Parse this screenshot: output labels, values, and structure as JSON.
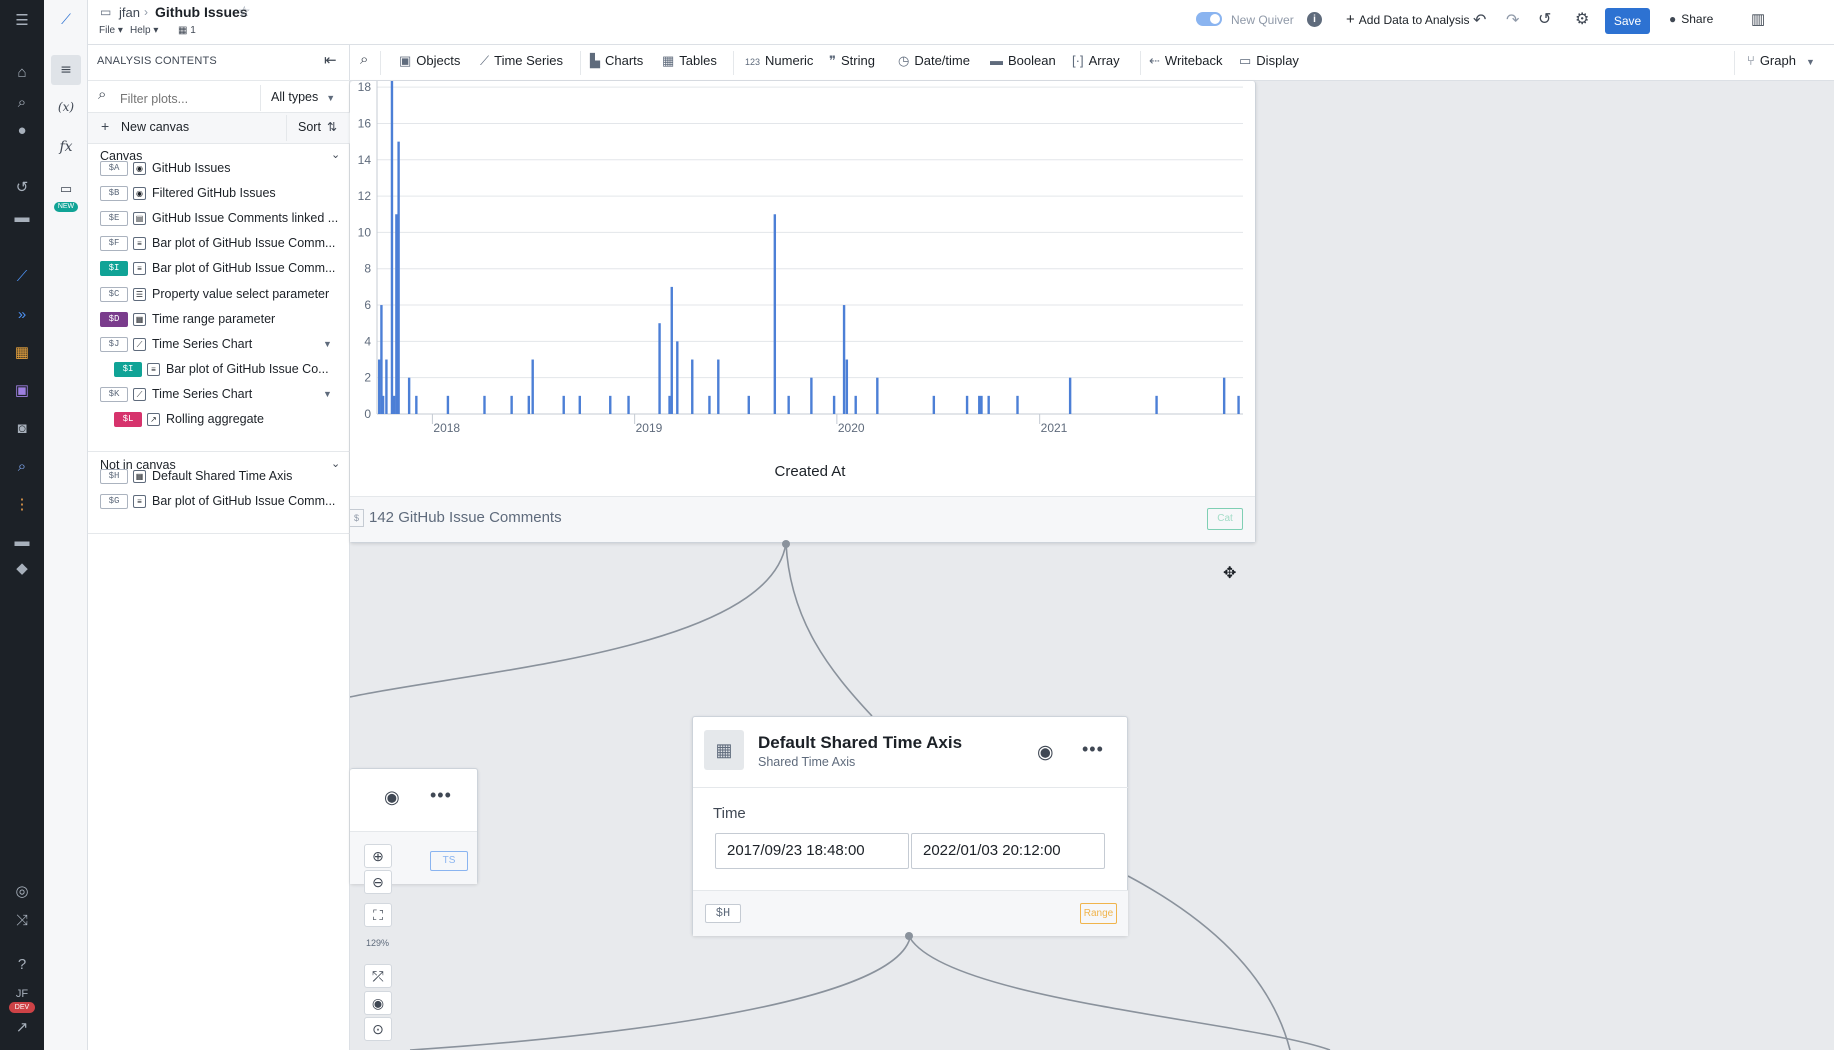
{
  "colors": {
    "accent": "#2d72d2",
    "bar": "#4c7fd6",
    "teal": "#10a396",
    "purple": "#7a3c8c",
    "pink": "#d6336c"
  },
  "header": {
    "breadcrumb_user": "jfan",
    "title": "Github Issues",
    "menu_file": "File",
    "menu_help": "Help",
    "count": "1",
    "new_quiver": "New Quiver",
    "add_data": "Add Data to Analysis",
    "save": "Save",
    "share": "Share"
  },
  "rail": {
    "badge": "NEW"
  },
  "user": {
    "initials": "JF",
    "badge": "DEV"
  },
  "sidebar": {
    "title": "ANALYSIS CONTENTS",
    "filter_placeholder": "Filter plots...",
    "types_select": "All types",
    "new_canvas": "New canvas",
    "sort": "Sort",
    "canvas_header": "Canvas",
    "not_in_canvas_header": "Not in canvas",
    "canvas_items": [
      {
        "tag": "$A",
        "label": "GitHub Issues",
        "icon": "object-set-icon"
      },
      {
        "tag": "$B",
        "label": "Filtered GitHub Issues",
        "icon": "object-set-icon"
      },
      {
        "tag": "$E",
        "label": "GitHub Issue Comments linked ...",
        "icon": "comment-icon"
      },
      {
        "tag": "$F",
        "label": "Bar plot of GitHub Issue Comm...",
        "icon": "bar-plot-icon"
      },
      {
        "tag": "$I",
        "label": "Bar plot of GitHub Issue Comm...",
        "icon": "bar-plot-icon"
      },
      {
        "tag": "$C",
        "label": "Property value select parameter",
        "icon": "list-icon"
      },
      {
        "tag": "$D",
        "label": "Time range parameter",
        "icon": "calendar-icon"
      },
      {
        "tag": "$J",
        "label": "Time Series Chart",
        "icon": "timeseries-icon"
      },
      {
        "tag": "$I",
        "label": "Bar plot of GitHub Issue Co...",
        "icon": "bar-plot-icon"
      },
      {
        "tag": "$K",
        "label": "Time Series Chart",
        "icon": "timeseries-icon"
      },
      {
        "tag": "$L",
        "label": "Rolling aggregate",
        "icon": "rolling-icon"
      }
    ],
    "other_items": [
      {
        "tag": "$H",
        "label": "Default Shared Time Axis",
        "icon": "calendar-icon"
      },
      {
        "tag": "$G",
        "label": "Bar plot of GitHub Issue Comm...",
        "icon": "bar-plot-icon"
      }
    ]
  },
  "toolbar": {
    "objects": "Objects",
    "time_series": "Time Series",
    "charts": "Charts",
    "tables": "Tables",
    "numeric": "Numeric",
    "numeric_glyph": "123",
    "string": "String",
    "datetime": "Date/time",
    "boolean": "Boolean",
    "array": "Array",
    "writeback": "Writeback",
    "display": "Display",
    "graph": "Graph"
  },
  "chart_card": {
    "footer_count": "142 GitHub Issue Comments",
    "footer_badge": "Cat",
    "footer_tag": "$"
  },
  "chart_data": {
    "type": "bar",
    "xlabel": "Created At",
    "ylabel": "",
    "x_ticks": [
      "2018",
      "2019",
      "2020",
      "2021"
    ],
    "y_ticks": [
      0,
      2,
      4,
      6,
      8,
      10,
      12,
      14,
      16,
      18
    ],
    "ylim": [
      0,
      19
    ],
    "xlim": [
      "2017-09-23",
      "2022-01-03"
    ],
    "series": [
      {
        "x": [
          "2017-09-27",
          "2017-10-01",
          "2017-10-04",
          "2017-10-10",
          "2017-10-20",
          "2017-10-24",
          "2017-10-28",
          "2017-11-01",
          "2017-11-20",
          "2017-12-03",
          "2018-01-29",
          "2018-04-05",
          "2018-05-24",
          "2018-06-24",
          "2018-07-01",
          "2018-08-26",
          "2018-09-24",
          "2018-11-18",
          "2018-12-21",
          "2019-02-15",
          "2019-03-05",
          "2019-03-09",
          "2019-03-19",
          "2019-04-15",
          "2019-05-16",
          "2019-06-01",
          "2019-07-26",
          "2019-09-11",
          "2019-10-06",
          "2019-11-16",
          "2019-12-27",
          "2020-01-14",
          "2020-01-19",
          "2020-02-04",
          "2020-03-14",
          "2020-06-24",
          "2020-08-23",
          "2020-09-14",
          "2020-09-18",
          "2020-10-01",
          "2020-11-22",
          "2021-02-25",
          "2021-07-31",
          "2021-11-30",
          "2021-12-26"
        ],
        "values": [
          3,
          6,
          1,
          3,
          19,
          1,
          11,
          15,
          2,
          1,
          1,
          1,
          1,
          1,
          3,
          1,
          1,
          1,
          1,
          5,
          1,
          7,
          4,
          3,
          1,
          3,
          1,
          11,
          1,
          2,
          1,
          6,
          3,
          1,
          2,
          1,
          1,
          1,
          1,
          1,
          1,
          2,
          1,
          2,
          1
        ]
      }
    ],
    "grid": true
  },
  "time_axis_card": {
    "title": "Default Shared Time Axis",
    "subtitle": "Shared Time Axis",
    "field_label": "Time",
    "start": "2017/09/23 18:48:00",
    "end": "2022/01/03 20:12:00",
    "tag": "$H",
    "badge": "Range"
  },
  "ts_card": {
    "badge": "TS"
  },
  "zoom": {
    "level": "129%"
  }
}
